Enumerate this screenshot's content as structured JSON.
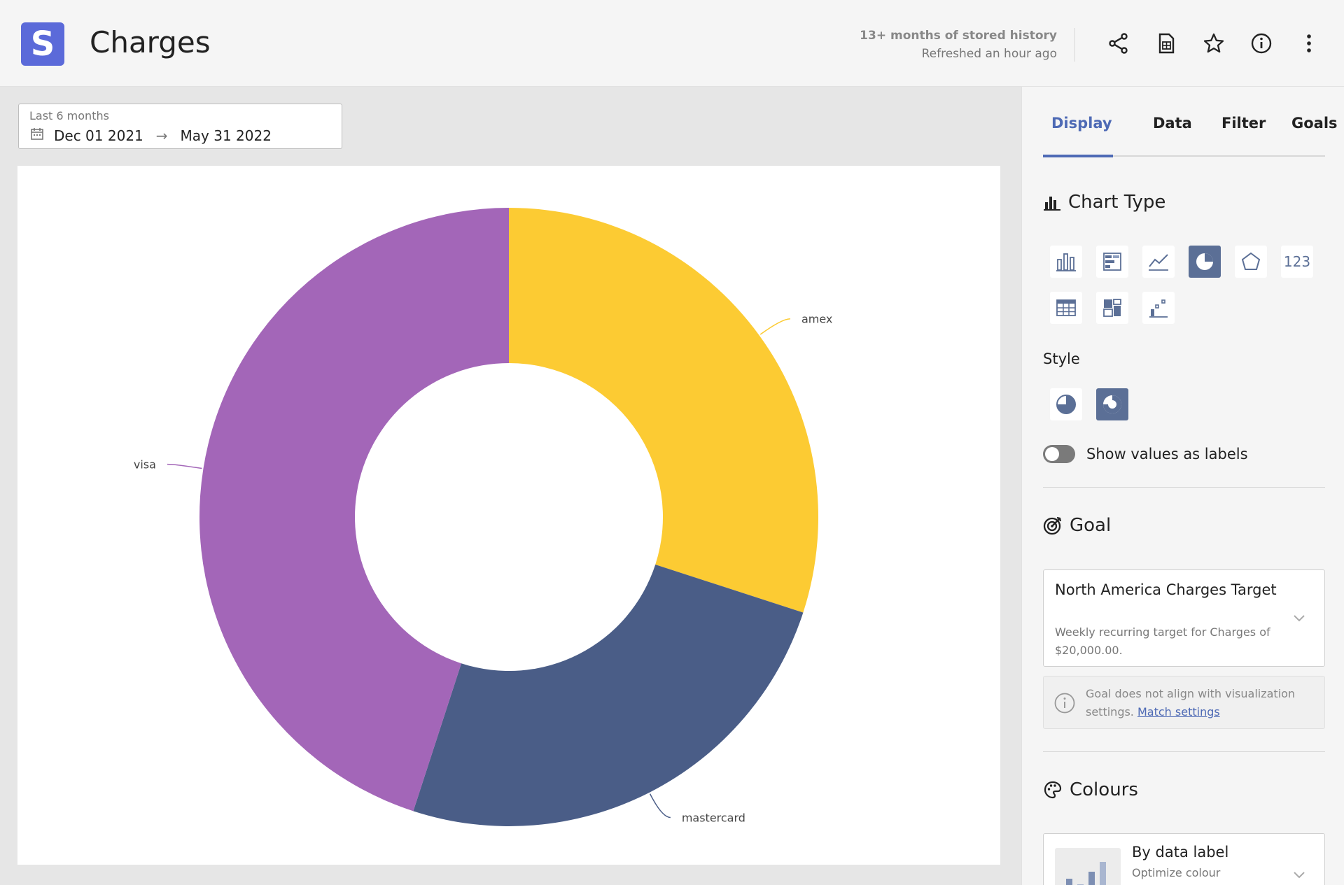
{
  "header": {
    "logo_letter": "S",
    "title": "Charges",
    "history_line1": "13+ months of stored history",
    "history_line2": "Refreshed an hour ago",
    "icons": [
      "share-icon",
      "csv-file-icon",
      "star-icon",
      "info-icon",
      "more-vertical-icon"
    ]
  },
  "date_range": {
    "caption": "Last 6 months",
    "start": "Dec 01 2021",
    "end": "May 31 2022"
  },
  "chart_data": {
    "type": "pie",
    "style": "donut",
    "categories": [
      "amex",
      "mastercard",
      "visa"
    ],
    "values": [
      30,
      25,
      45
    ],
    "colors": [
      "#fccb33",
      "#4a5d87",
      "#a366b8"
    ]
  },
  "panel": {
    "tabs": [
      {
        "label": "Display",
        "active": true
      },
      {
        "label": "Data",
        "active": false
      },
      {
        "label": "Filter",
        "active": false
      },
      {
        "label": "Goals",
        "active": false
      }
    ],
    "chart_type_title": "Chart Type",
    "chart_types": [
      "bar",
      "stacked-bar",
      "line",
      "pie",
      "radar",
      "number",
      "table",
      "treemap",
      "funnel"
    ],
    "chart_type_selected": "pie",
    "number_label": "123",
    "style_label": "Style",
    "styles": [
      "pie",
      "donut"
    ],
    "style_selected": "donut",
    "show_values_label": "Show values as labels",
    "show_values_on": false,
    "goal_title": "Goal",
    "goal_name": "North America Charges Target",
    "goal_description": "Weekly recurring target for Charges of $20,000.00.",
    "goal_note": "Goal does not align with visualization settings.",
    "goal_note_link": "Match settings",
    "colours_title": "Colours",
    "colour_mode_name": "By data label",
    "colour_mode_sub": "Optimize colour",
    "accent": "#4e6ab5",
    "selected_bg": "#5b6f96"
  }
}
